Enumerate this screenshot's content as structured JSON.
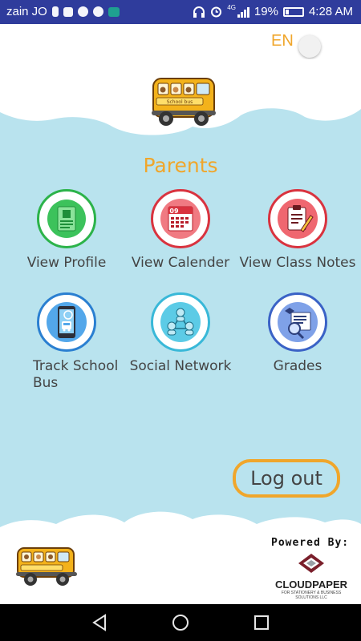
{
  "status_bar": {
    "carrier": "zain JO",
    "network": "4G",
    "battery": "19%",
    "battery_level": 0.19,
    "time": "4:28 AM",
    "icons_left": [
      "battery-saver-icon",
      "image-icon",
      "hotspot-icon",
      "pinterest-icon",
      "app-icon"
    ],
    "icons_right": [
      "headphones-icon",
      "alarm-icon",
      "signal-icon",
      "battery-icon"
    ]
  },
  "header": {
    "language": "EN"
  },
  "section_title": "Parents",
  "menu": [
    {
      "label": "View Profile",
      "icon": "profile-card-icon",
      "ring": "#2cb34a"
    },
    {
      "label": "View Calender",
      "icon": "calendar-icon",
      "ring": "#d9333f"
    },
    {
      "label": "View Class Notes",
      "icon": "clipboard-icon",
      "ring": "#d9333f"
    },
    {
      "label": "Track School Bus",
      "icon": "phone-bus-icon",
      "ring": "#2a7fd1"
    },
    {
      "label": "Social Network",
      "icon": "network-icon",
      "ring": "#39b8d8"
    },
    {
      "label": "Grades",
      "icon": "grades-icon",
      "ring": "#3a62c6"
    }
  ],
  "calendar_icon_day": "09",
  "bus_sign": "School bus",
  "logout_label": "Log out",
  "footer": {
    "powered_by": "Powered By:",
    "brand": "CLOUDPAPER",
    "brand_sub": "FOR STATIONERY & BUSINESS SOLUTIONS LLC"
  },
  "colors": {
    "accent": "#f0a62b",
    "background": "#b9e3ee",
    "status_bar": "#2f3c9c"
  }
}
